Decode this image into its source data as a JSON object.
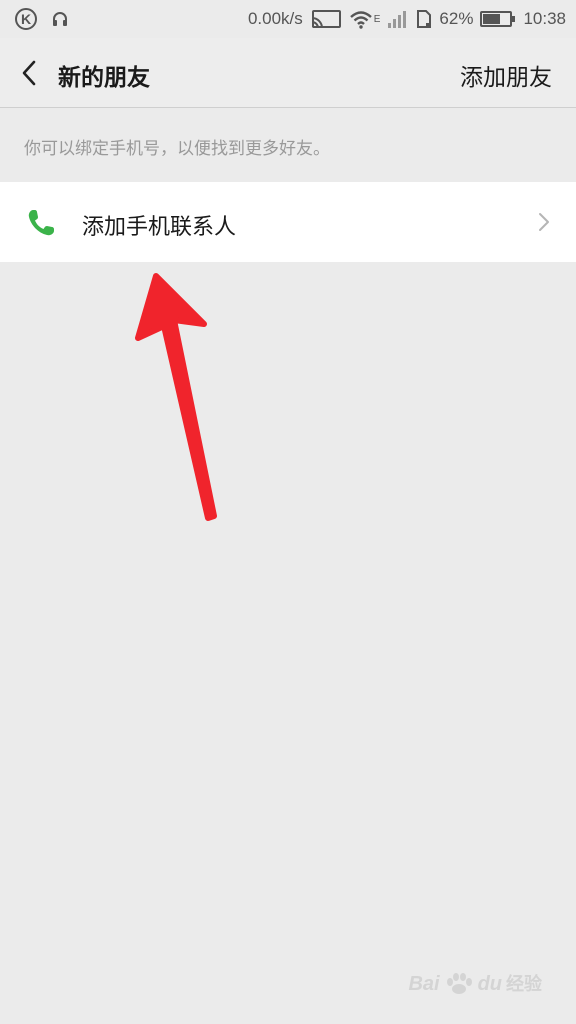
{
  "status_bar": {
    "k_badge": "K",
    "net_speed": "0.00k/s",
    "network_type": "E",
    "battery_percent": "62%",
    "time": "10:38",
    "icons": [
      "k-app-icon",
      "headphones-icon",
      "cast-icon",
      "wifi-icon",
      "signal-icon",
      "sim-icon",
      "battery-icon"
    ]
  },
  "header": {
    "title": "新的朋友",
    "action": "添加朋友"
  },
  "hint": "你可以绑定手机号，以便找到更多好友。",
  "contact_row": {
    "label": "添加手机联系人",
    "icon": "phone-icon"
  },
  "colors": {
    "background": "#ebebeb",
    "row_background": "#ffffff",
    "phone_green": "#3bb34a",
    "arrow_red": "#f0242c"
  },
  "watermark": {
    "brand": "Bai",
    "brand_tail": "du",
    "text": "经验"
  }
}
